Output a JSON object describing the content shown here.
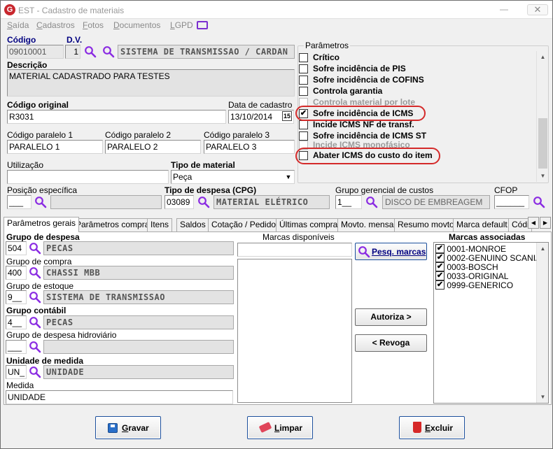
{
  "window": {
    "title": "EST - Cadastro de materiais",
    "minimize": "—",
    "close": "✕",
    "app_icon": "G"
  },
  "menu": [
    {
      "label": "Saída",
      "u": "S",
      "rest": "aída"
    },
    {
      "label": "Cadastros",
      "u": "C",
      "rest": "adastros"
    },
    {
      "label": "Fotos",
      "u": "F",
      "rest": "otos"
    },
    {
      "label": "Documentos",
      "u": "D",
      "rest": "ocumentos"
    },
    {
      "label": "LGPD",
      "u": "L",
      "rest": "GPD"
    }
  ],
  "codigo": {
    "label": "Código",
    "value": "09010001"
  },
  "dv": {
    "label": "D.V.",
    "value": "1"
  },
  "material_desc_readonly": "SISTEMA DE TRANSMISSAO / CARDAN",
  "descricao": {
    "label": "Descrição",
    "value": "MATERIAL CADASTRADO PARA TESTES"
  },
  "codigo_original": {
    "label": "Código original",
    "value": "R3031"
  },
  "data_cadastro": {
    "label": "Data de cadastro",
    "value": "13/10/2014",
    "cal": "15"
  },
  "codigo_paralelo_1": {
    "label": "Código paralelo 1",
    "value": "PARALELO 1"
  },
  "codigo_paralelo_2": {
    "label": "Código paralelo 2",
    "value": "PARALELO 2"
  },
  "codigo_paralelo_3": {
    "label": "Código paralelo 3",
    "value": "PARALELO 3"
  },
  "utilizacao": {
    "label": "Utilização",
    "value": ""
  },
  "tipo_material": {
    "label": "Tipo de material",
    "value": "Peça"
  },
  "posicao_especifica": {
    "label": "Posição específica",
    "value": "___"
  },
  "tipo_despesa": {
    "label": "Tipo de despesa (CPG)",
    "code": "03089",
    "desc": "MATERIAL ELÉTRICO"
  },
  "grupo_gerencial": {
    "label": "Grupo gerencial de custos",
    "code": "1__",
    "desc": "DISCO DE EMBREAGEM"
  },
  "cfop": {
    "label": "CFOP",
    "value": "______"
  },
  "parametros": {
    "title": "Parâmetros",
    "items": [
      {
        "label": "Crítico",
        "checked": false,
        "disabled": false
      },
      {
        "label": "Sofre incidência de PIS",
        "checked": false,
        "disabled": false
      },
      {
        "label": "Sofre incidência de COFINS",
        "checked": false,
        "disabled": false
      },
      {
        "label": "Controla garantia",
        "checked": false,
        "disabled": false
      },
      {
        "label": "Controla material por lote",
        "checked": false,
        "disabled": true
      },
      {
        "label": "Sofre incidência de ICMS",
        "checked": true,
        "disabled": false
      },
      {
        "label": "Incide ICMS NF de transf.",
        "checked": false,
        "disabled": false
      },
      {
        "label": "Sofre incidência de ICMS ST",
        "checked": false,
        "disabled": false
      },
      {
        "label": "Incide ICMS monofásico",
        "checked": false,
        "disabled": true
      },
      {
        "label": "Abater ICMS do custo do item",
        "checked": false,
        "disabled": false
      }
    ]
  },
  "tabs": [
    "Parâmetros gerais",
    "Parâmetros compras",
    "Itens",
    "Saldos",
    "Cotação / Pedido",
    "Últimas compras",
    "Movto. mensal",
    "Resumo movto.",
    "Marca default",
    "Códi"
  ],
  "grupo_despesa": {
    "label": "Grupo de despesa",
    "code": "504",
    "desc": "PECAS"
  },
  "grupo_compra": {
    "label": "Grupo de compra",
    "code": "400",
    "desc": "CHASSI MBB"
  },
  "grupo_estoque": {
    "label": "Grupo de estoque",
    "code": "9__",
    "desc": "SISTEMA DE TRANSMISSAO"
  },
  "grupo_contabil": {
    "label": "Grupo contábil",
    "code": "4__",
    "desc": "PECAS"
  },
  "grupo_despesa_hidro": {
    "label": "Grupo de despesa hidroviário",
    "code": "___",
    "desc": ""
  },
  "unidade_medida": {
    "label": "Unidade de medida",
    "code": "UN_",
    "desc": "UNIDADE"
  },
  "medida": {
    "label": "Medida",
    "value": "UNIDADE"
  },
  "marcas_disponiveis": {
    "label": "Marcas disponíveis",
    "filter": ""
  },
  "buttons": {
    "pesq_marcas": "Pesq. marcas",
    "autoriza": "Autoriza >",
    "revoga": "< Revoga",
    "gravar": "Gravar",
    "limpar": "Limpar",
    "excluir": "Excluir"
  },
  "marcas_associadas": {
    "label": "Marcas associadas",
    "items": [
      "0001-MONROE",
      "0002-GENUINO SCANIA",
      "0003-BOSCH",
      "0033-ORIGINAL",
      "0999-GENERICO"
    ]
  },
  "colors": {
    "label_accent": "#000080",
    "highlight_circle": "#d42a2a",
    "search_icon": "#8a2be2"
  }
}
